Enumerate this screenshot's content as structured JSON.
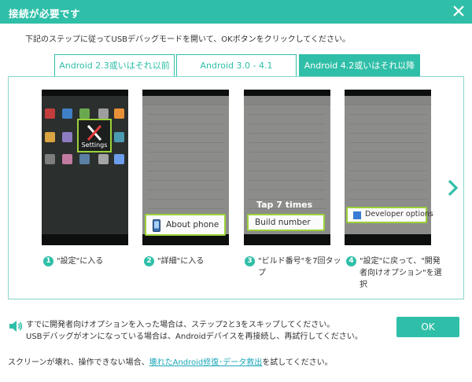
{
  "window": {
    "title": "接続が必要です",
    "accent_color": "#2fbfa8"
  },
  "instruction": "下記のステップに従ってUSBデバッグモードを開いて、OKボタンをクリックしてください。",
  "tabs": [
    {
      "label": "Android 2.3或いはそれ以前",
      "active": false
    },
    {
      "label": "Android 3.0 - 4.1",
      "active": false
    },
    {
      "label": "Android 4.2或いはそれ以降",
      "active": true
    }
  ],
  "phones": {
    "phone1_callout": "Settings",
    "phone2_callout": "About phone",
    "phone3_tap": "Tap 7 times",
    "phone3_callout": "Build number",
    "phone4_callout": "Developer options"
  },
  "steps": [
    {
      "num": "1",
      "text": "\"設定\"に入る"
    },
    {
      "num": "2",
      "text": "\"詳細\"に入る"
    },
    {
      "num": "3",
      "text": "\"ビルド番号\"を7回タップ"
    },
    {
      "num": "4",
      "text": "\"設定\"に戻って、\"開発者向けオプション\"を選択"
    }
  ],
  "notes": {
    "line1": "すでに開発者向けオプションを入った場合は、ステップ2と3をスキップしてください。",
    "line2": "USBデバッグがオンになっている場合は、Androidデバイスを再接続し、再試行してください。"
  },
  "ok_label": "OK",
  "footer": {
    "prefix": "スクリーンが壊れ、操作できない場合、",
    "link": "壊れたAndroid修復･データ救出",
    "suffix": "を試してください。"
  }
}
